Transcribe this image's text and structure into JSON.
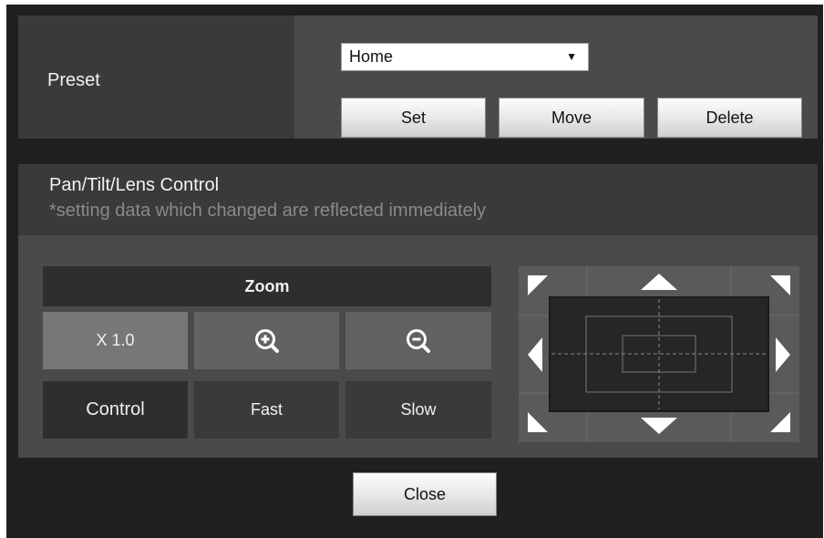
{
  "preset": {
    "label": "Preset",
    "selected": "Home",
    "buttons": {
      "set": "Set",
      "move": "Move",
      "delete": "Delete"
    }
  },
  "ptz": {
    "title": "Pan/Tilt/Lens Control",
    "note": "*setting data which changed are reflected immediately",
    "zoom_label": "Zoom",
    "zoom_value": "X 1.0",
    "control_label": "Control",
    "speed_fast": "Fast",
    "speed_slow": "Slow",
    "icons": [
      "zoom-in-icon",
      "zoom-out-icon",
      "arrow-up-icon",
      "arrow-down-icon",
      "arrow-left-icon",
      "arrow-right-icon",
      "arrow-up-left-icon",
      "arrow-up-right-icon",
      "arrow-down-left-icon",
      "arrow-down-right-icon"
    ]
  },
  "footer": {
    "close": "Close"
  },
  "colors": {
    "panel_dark": "#3a3a3a",
    "panel_mid": "#4a4a4a",
    "frame": "#202020"
  }
}
